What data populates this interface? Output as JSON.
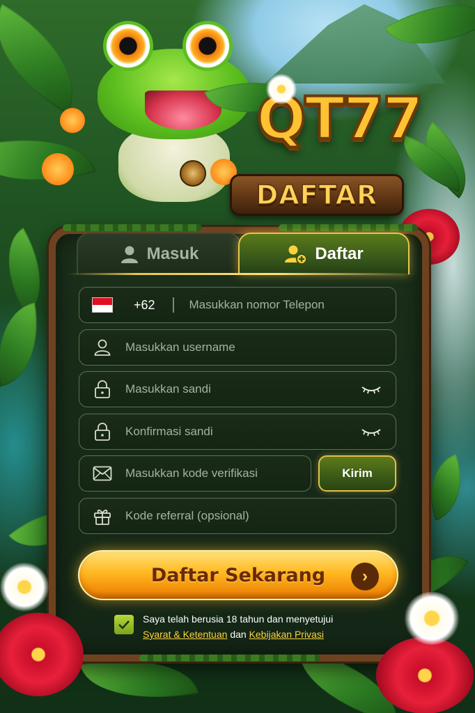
{
  "brand": {
    "logo_text": "QT77",
    "logo_subtitle": "DAFTAR"
  },
  "tabs": {
    "login_label": "Masuk",
    "register_label": "Daftar",
    "active": "Daftar"
  },
  "form": {
    "phone": {
      "country_code": "+62",
      "flag": "indonesia-flag",
      "placeholder": "Masukkan nomor Telepon"
    },
    "username": {
      "placeholder": "Masukkan username",
      "icon": "user-icon"
    },
    "password": {
      "placeholder": "Masukkan sandi",
      "icon": "lock-icon"
    },
    "confirm_password": {
      "placeholder": "Konfirmasi sandi",
      "icon": "lock-icon"
    },
    "verification": {
      "placeholder": "Masukkan kode verifikasi",
      "icon": "mail-icon",
      "send_label": "Kirim"
    },
    "referral": {
      "placeholder": "Kode referral (opsional)",
      "icon": "gift-icon"
    },
    "submit_label": "Daftar Sekarang",
    "agreement": {
      "checked": true,
      "text_before": "Saya telah berusia 18 tahun dan menyetujui",
      "terms_link": "Syarat & Ketentuan",
      "conjunction": "dan",
      "privacy_link": "Kebijakan Privasi"
    }
  },
  "colors": {
    "accent_gold": "#ffc232",
    "panel_bg": "#142616",
    "tab_active_border": "#e8c64a",
    "link_color": "#ffd23a"
  }
}
